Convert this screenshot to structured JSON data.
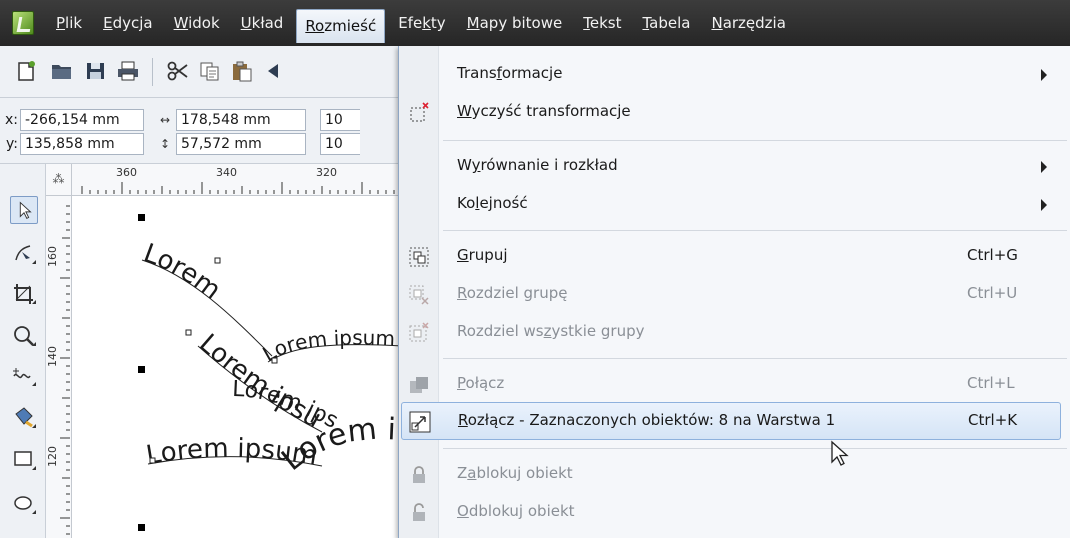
{
  "menubar": {
    "items": [
      {
        "pre": "",
        "u": "P",
        "post": "lik"
      },
      {
        "pre": "",
        "u": "E",
        "post": "dycja"
      },
      {
        "pre": "",
        "u": "W",
        "post": "idok"
      },
      {
        "pre": "",
        "u": "U",
        "post": "kład"
      },
      {
        "pre": "",
        "u": "Ro",
        "post": "zmieść"
      },
      {
        "pre": "Efe",
        "u": "k",
        "post": "ty"
      },
      {
        "pre": "",
        "u": "M",
        "post": "apy bitowe"
      },
      {
        "pre": "",
        "u": "T",
        "post": "ekst"
      },
      {
        "pre": "",
        "u": "T",
        "post": "abela"
      },
      {
        "pre": "",
        "u": "N",
        "post": "arzędzia"
      }
    ]
  },
  "propbar": {
    "x_label": "x:",
    "x_value": "-266,154 mm",
    "y_label": "y:",
    "y_value": "135,858 mm",
    "w_value": "178,548 mm",
    "h_value": "57,572 mm",
    "scale_x": "10",
    "scale_y": "10"
  },
  "ruler": {
    "top": [
      "360",
      "340",
      "320"
    ],
    "left": [
      "160",
      "140",
      "120"
    ]
  },
  "canvas": {
    "text_paths": [
      "Lorem",
      "Lorem ipsum",
      "Lorem ipsum dol",
      "Lorem ipsum",
      "Lorem ipsum",
      "Lorem ipsum"
    ]
  },
  "dropdown": {
    "items": [
      {
        "pre": "Trans",
        "u": "f",
        "post": "ormacje",
        "shortcut": "",
        "submenu": true
      },
      {
        "pre": "",
        "u": "W",
        "post": "yczyść transformacje",
        "shortcut": "",
        "submenu": false
      },
      {
        "pre": "W",
        "u": "y",
        "post": "równanie i rozkład",
        "shortcut": "",
        "submenu": true
      },
      {
        "pre": "Ko",
        "u": "l",
        "post": "ejność",
        "shortcut": "",
        "submenu": true
      },
      {
        "pre": "",
        "u": "G",
        "post": "rupuj",
        "shortcut": "Ctrl+G",
        "submenu": false
      },
      {
        "pre": "",
        "u": "R",
        "post": "ozdziel grupę",
        "shortcut": "Ctrl+U",
        "submenu": false
      },
      {
        "pre": "Rozdziel ws",
        "u": "z",
        "post": "ystkie grupy",
        "shortcut": "",
        "submenu": false
      },
      {
        "pre": "",
        "u": "P",
        "post": "ołącz",
        "shortcut": "Ctrl+L",
        "submenu": false
      },
      {
        "pre": "",
        "u": "R",
        "post": "ozłącz - Zaznaczonych obiektów: 8 na Warstwa 1",
        "shortcut": "Ctrl+K",
        "submenu": false
      },
      {
        "pre": "Z",
        "u": "a",
        "post": "blokuj obiekt",
        "shortcut": "",
        "submenu": false
      },
      {
        "pre": "",
        "u": "O",
        "post": "dblokuj obiekt",
        "shortcut": "",
        "submenu": false
      }
    ]
  },
  "colors": {
    "menubar_bg": "#2f2f2f",
    "hover_border": "#8eb1dd",
    "disabled_text": "#8a8f96"
  }
}
